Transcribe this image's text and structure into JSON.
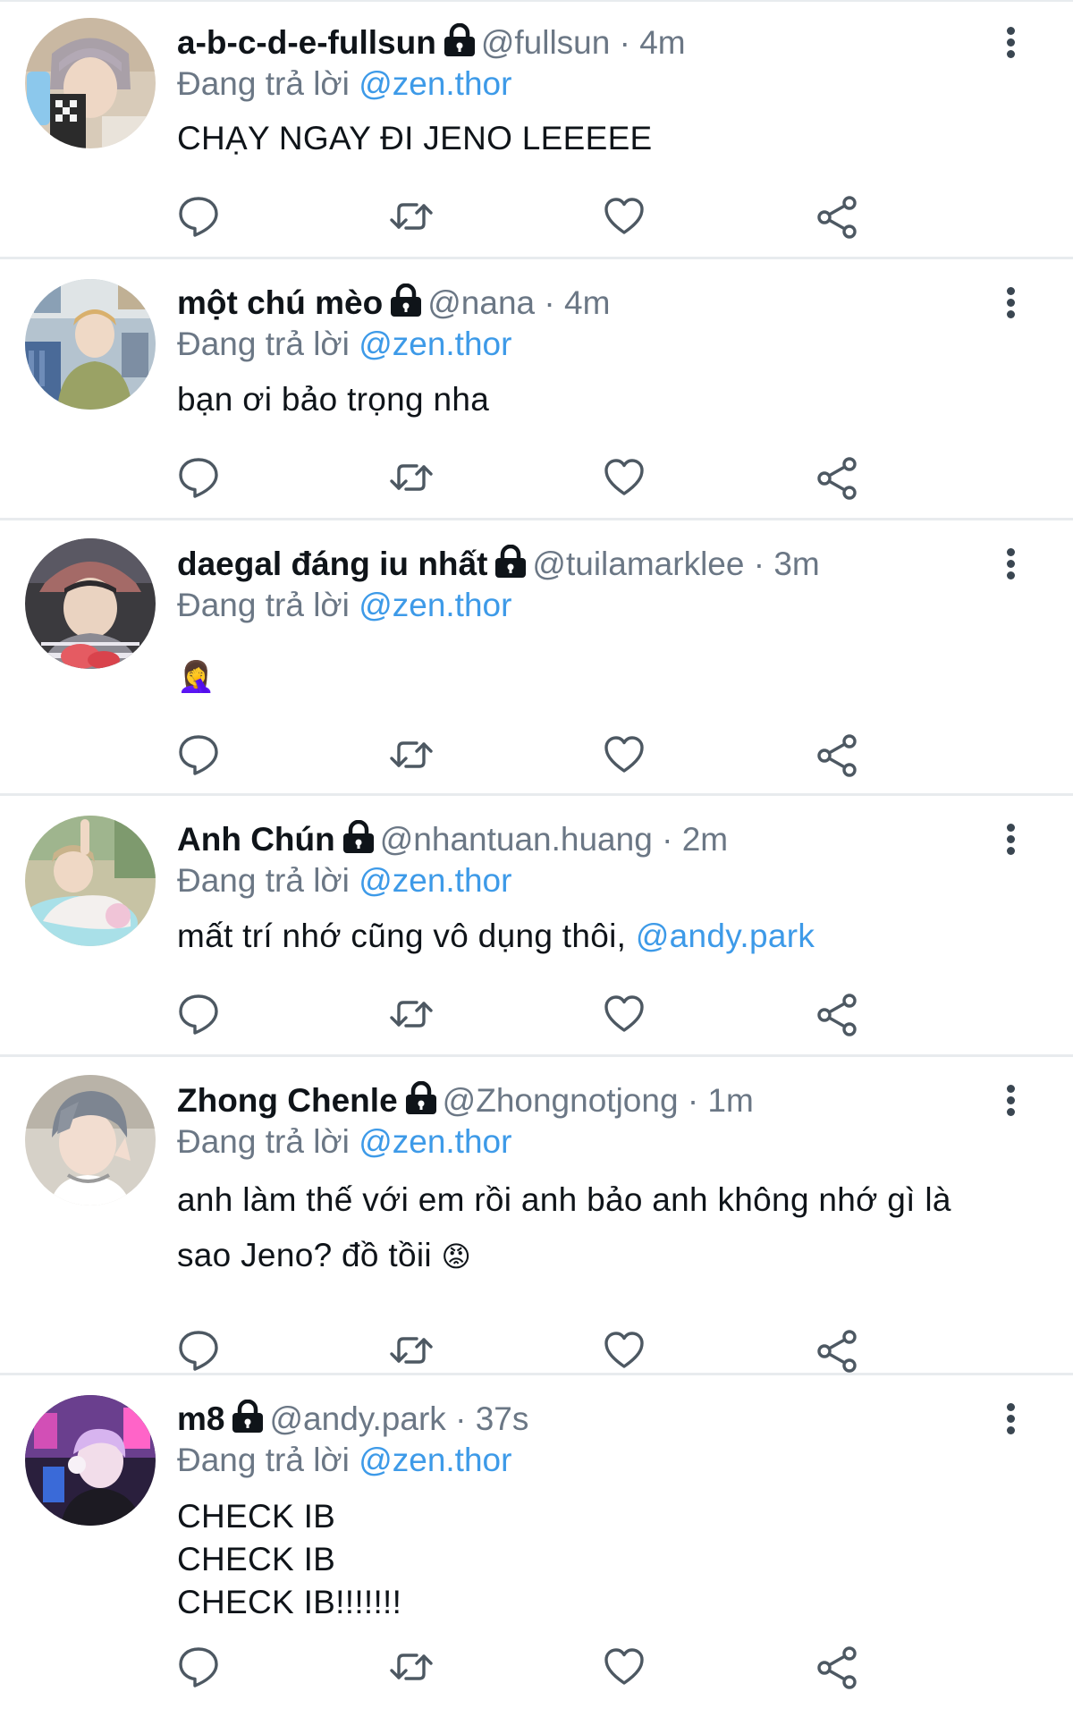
{
  "reply_prefix": "Đang trả lời",
  "meta_separator": "·",
  "icons": {
    "lock": "lock-icon",
    "more": "more-vertical-icon",
    "reply": "speech-bubble-icon",
    "retweet": "retweet-icon",
    "like": "heart-icon",
    "share": "share-icon"
  },
  "colors": {
    "link": "#3d9ae8",
    "secondary_text": "#6b7785",
    "divider": "#e8ebee"
  },
  "tweets": [
    {
      "name": "a-b-c-d-e-fullsun",
      "handle": "@fullsun",
      "time": "4m",
      "reply_to": "@zen.thor",
      "lines": [
        "CHẠY NGAY ĐI JENO LEEEEE"
      ]
    },
    {
      "name": "một chú mèo",
      "handle": "@nana",
      "time": "4m",
      "reply_to": "@zen.thor",
      "lines": [
        "bạn ơi bảo trọng nha"
      ]
    },
    {
      "name": "daegal đáng iu nhất",
      "handle": "@tuilamarklee",
      "time": "3m",
      "reply_to": "@zen.thor",
      "emoji": "🤦‍♀️"
    },
    {
      "name": "Anh Chún",
      "handle": "@nhantuan.huang",
      "time": "2m",
      "reply_to": "@zen.thor",
      "lines": [
        "mất trí nhớ cũng vô dụng thôi,"
      ],
      "mention": "@andy.park"
    },
    {
      "name": "Zhong Chenle",
      "handle": "@Zhongnotjong",
      "time": "1m",
      "reply_to": "@zen.thor",
      "lines": [
        "anh làm thế với em rồi anh bảo anh không nhớ gì là",
        "sao Jeno? đồ tồii"
      ],
      "emoji": "😡"
    },
    {
      "name": "m8",
      "handle": "@andy.park",
      "time": "37s",
      "reply_to": "@zen.thor",
      "lines": [
        "CHECK IB",
        "CHECK IB",
        "CHECK IB!!!!!!!"
      ]
    }
  ]
}
